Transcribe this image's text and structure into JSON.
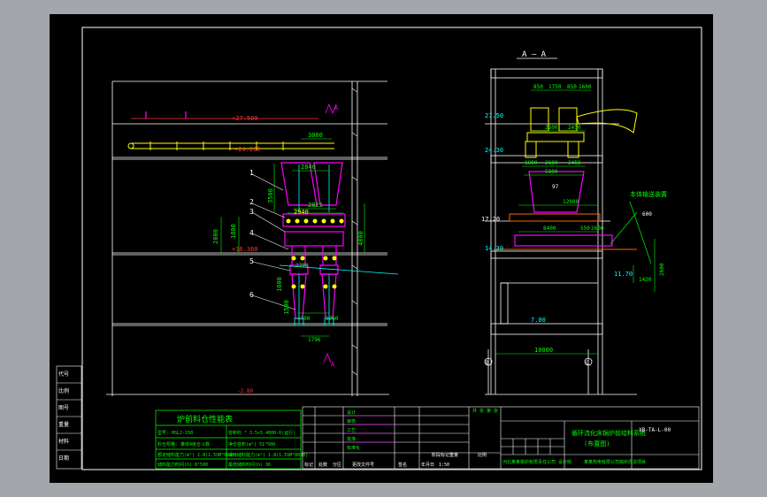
{
  "section": {
    "title": "A — A"
  },
  "left_view": {
    "elevations": {
      "top": "+27.500",
      "mid": "+24.200",
      "low": "+16.360"
    },
    "widths": {
      "top": "3000",
      "upper": "2840",
      "mid": "2940",
      "hopper": "2825"
    },
    "heights": {
      "left": "2800",
      "right": "3500",
      "right2": "4800",
      "h1": "1600",
      "h2": "1500",
      "h3": "1800"
    },
    "dims_small": {
      "a": "2700",
      "b": "1700",
      "c": "1700",
      "d": "1796"
    },
    "callouts": [
      "1",
      "2",
      "3",
      "4",
      "5",
      "6"
    ],
    "section_marks": {
      "top": "A",
      "bottom": "A"
    },
    "level_mark": "-2.80"
  },
  "right_view": {
    "levels": {
      "l1": "27.50",
      "l2": "24.30",
      "l3": "17.20",
      "l4": "14.30",
      "l5": "11.70",
      "l6": "7.00"
    },
    "top_dims": [
      "850",
      "1750",
      "850",
      "1600"
    ],
    "dims_row1": [
      "2600",
      "2450"
    ],
    "dims_row2": [
      "1800",
      "2600",
      "2450"
    ],
    "dim_5800": "5800",
    "dim_12000": "12000",
    "dim_8400": "8400",
    "dims_small": [
      "550",
      "2600"
    ],
    "dim_600": "600",
    "dim_2600": "2600",
    "dim_1420": "1420",
    "dim_10000": "10000",
    "ref_mark": "97",
    "label_conveyor": "本体输送装置",
    "grid_axes": [
      "B",
      "C"
    ]
  },
  "title_block": {
    "table_title": "炉前料仓性能表",
    "rows": [
      [
        "型号: HSLJ-150",
        "容积约 ³ 3.5×5.4000-6(运行)"
      ],
      [
        "料仓规格: 锥体4级仓斗数",
        "净仓容积(m³) 51³500"
      ],
      [
        "额定储料能力(m³) 2.8(1.5SM³0040)",
        "设计储料能力(m³) 1.8(1.5SM³0030)"
      ],
      [
        "储料能力时间(h) 8¹500",
        "最低储料时间(h) 36"
      ]
    ],
    "main_title": "循环流化床锅炉前给料系统",
    "sub_title": "(布置图)",
    "drawing_no": "XB-TA-L-00",
    "company": "河北某某锅炉有限责任公司 设计院",
    "project": "某某热电有限公司锅炉改造项目",
    "footer_labels": [
      "标记",
      "处数",
      "分区",
      "更改文件号",
      "签名",
      "年月日"
    ],
    "mid_labels": [
      "设计",
      "审核",
      "工艺",
      "批准",
      "标准化"
    ],
    "stage_labels": [
      "阶段标记",
      "重量",
      "比例"
    ],
    "ratio": "1:50",
    "sheet": "共 张 第 张",
    "left_margin": [
      "代号",
      "比例",
      "图号",
      "重量",
      "材料",
      "日期"
    ]
  }
}
